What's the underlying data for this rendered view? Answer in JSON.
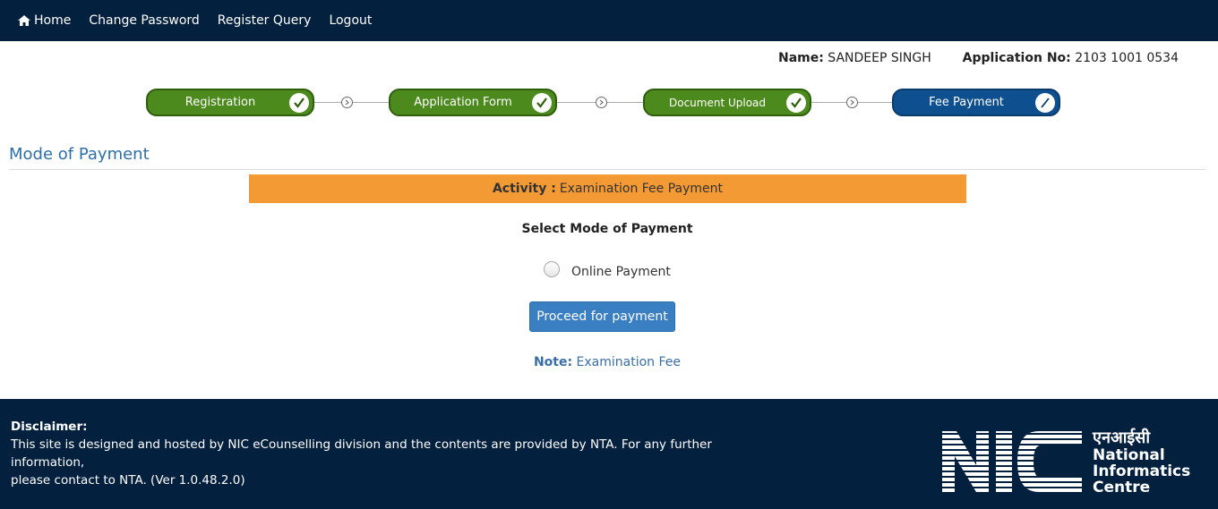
{
  "nav": {
    "home": "Home",
    "change_password": "Change Password",
    "register_query": "Register Query",
    "logout": "Logout"
  },
  "user": {
    "name_label": "Name:",
    "name_value": "SANDEEP SINGH",
    "app_label": "Application No:",
    "app_value": "2103 1001 0534"
  },
  "steps": [
    {
      "label": "Registration",
      "status": "done"
    },
    {
      "label": "Application Form",
      "status": "done"
    },
    {
      "label": "Document Upload",
      "status": "done"
    },
    {
      "label": "Fee Payment",
      "status": "active"
    }
  ],
  "colors": {
    "navbar": "#04203f",
    "step_done": "#4c8a1e",
    "step_active": "#0e4f8f",
    "activity_bg": "#f39a35",
    "button": "#3a7fc1",
    "title": "#2f6fa6"
  },
  "main": {
    "title": "Mode of Payment",
    "activity_label": "Activity :",
    "activity_value": "Examination Fee Payment",
    "select_label": "Select Mode of Payment",
    "radio_label": "Online Payment",
    "proceed_label": "Proceed for payment",
    "note_label": "Note:",
    "note_value": "Examination Fee"
  },
  "footer": {
    "disclaimer_title": "Disclaimer:",
    "disclaimer_line1": "This site is designed and hosted by NIC eCounselling division and the contents are provided by NTA. For any further information,",
    "disclaimer_line2": "please contact to NTA. (Ver 1.0.48.2.0)",
    "logo_hindi": "एनआईसी",
    "logo_line1": "National",
    "logo_line2": "Informatics",
    "logo_line3": "Centre",
    "logo_mark": "NIC"
  }
}
